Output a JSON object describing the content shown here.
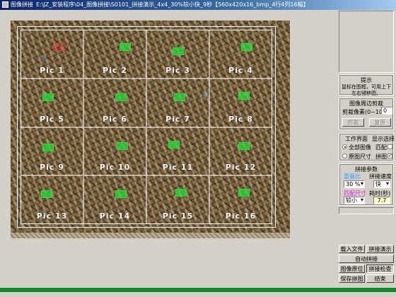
{
  "window": {
    "title": "图像拼接",
    "path": "E:\\JZ_安装程序\\04_图像拼接\\S0101_拼接演示_4x4_30%较小快_9秒【560x420x16_bmp_4行4列16幅】",
    "title_mid": ""
  },
  "tiles": [
    "Pic 1",
    "Pic 2",
    "Pic 3",
    "Pic 4",
    "Pic 5",
    "Pic 6",
    "Pic 7",
    "Pic 8",
    "Pic 9",
    "Pic 10",
    "Pic 11",
    "Pic 12",
    "Pic 13",
    "Pic 14",
    "Pic 15",
    "Pic 16"
  ],
  "hint": {
    "title": "提示",
    "text": "鼠标在图框，可用上下左右键移图。"
  },
  "crop": {
    "title": "图像周边剪裁",
    "pixels_label": "剪裁像素(0~10)",
    "pixels_value": "0",
    "btn_crop": "剪裁",
    "btn_restore": "复原"
  },
  "display": {
    "work_title": "工作界面",
    "show_title": "显示选择",
    "opt_full": "全部图像",
    "opt_orig": "原图尺寸",
    "chk_match": "匹配",
    "chk_stitch": "拼图",
    "chk_stitch_checked": "✓"
  },
  "stitch": {
    "title": "拼接参数",
    "ratio_label": "重叠比",
    "ratio_value": "30 %",
    "speed_label": "拼接速度",
    "speed_value": "快",
    "match_size_label": "匹配尺寸",
    "match_size_value": "较小",
    "time_label": "耗时(秒)",
    "time_value": "7.7"
  },
  "buttons": {
    "load_file": "载入文件",
    "demo": "拼接演示",
    "auto": "自动拼接",
    "reset": "图像原位",
    "check": "拼接检查",
    "save": "保存拼图",
    "exit": "结束"
  },
  "progress": {
    "fraction": 1.0,
    "color": "#0a8a2a"
  }
}
